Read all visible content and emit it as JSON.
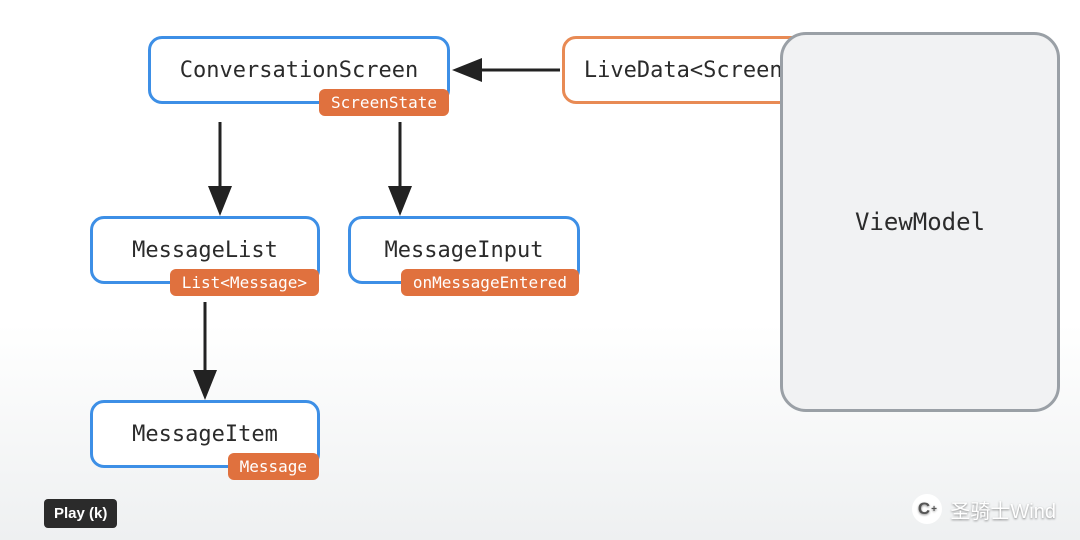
{
  "nodes": {
    "conversationScreen": {
      "label": "ConversationScreen",
      "tag": "ScreenState"
    },
    "liveData": {
      "label": "LiveData<ScreenState>"
    },
    "messageList": {
      "label": "MessageList",
      "tag": "List<Message>"
    },
    "messageInput": {
      "label": "MessageInput",
      "tag": "onMessageEntered"
    },
    "messageItem": {
      "label": "MessageItem",
      "tag": "Message"
    },
    "viewModel": {
      "label": "ViewModel"
    }
  },
  "tooltip": "Play (k)",
  "watermark": "圣骑士Wind",
  "colors": {
    "blueBorder": "#3d8fe6",
    "orangeBorder": "#e88a54",
    "grayBorder": "#9aa0a6",
    "tagFill": "#e0713e",
    "arrow": "#222222"
  }
}
